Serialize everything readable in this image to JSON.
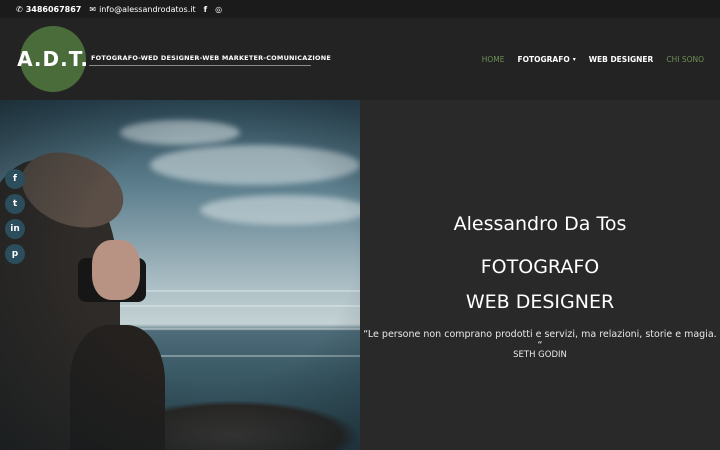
{
  "topbar": {
    "phone": "3486067867",
    "email": "info@alessandrodatos.it",
    "facebook_icon": "f",
    "instagram_icon": "◎"
  },
  "header": {
    "logo_text": "A.D.T.",
    "tagline": "FOTOGRAFO-WED DESIGNER-WEB MARKETER-COMUNICAZIONE",
    "nav": {
      "home": "HOME",
      "fotografo": "FOTOGRAFO",
      "web_designer": "WEB DESIGNER",
      "chi_sono": "CHI SONO"
    }
  },
  "social": {
    "facebook": "f",
    "twitter": "t",
    "linkedin": "in",
    "pinterest": "p"
  },
  "hero": {
    "name": "Alessandro Da Tos",
    "role1": "FOTOGRAFO",
    "role2": "WEB DESIGNER",
    "quote": "“Le persone non comprano prodotti e servizi, ma relazioni, storie e magia. “",
    "author": "SETH GODIN"
  },
  "colors": {
    "accent_green": "#6e8f55",
    "logo_bg": "#4a6b3a",
    "social_bg": "#2b4d5c"
  }
}
